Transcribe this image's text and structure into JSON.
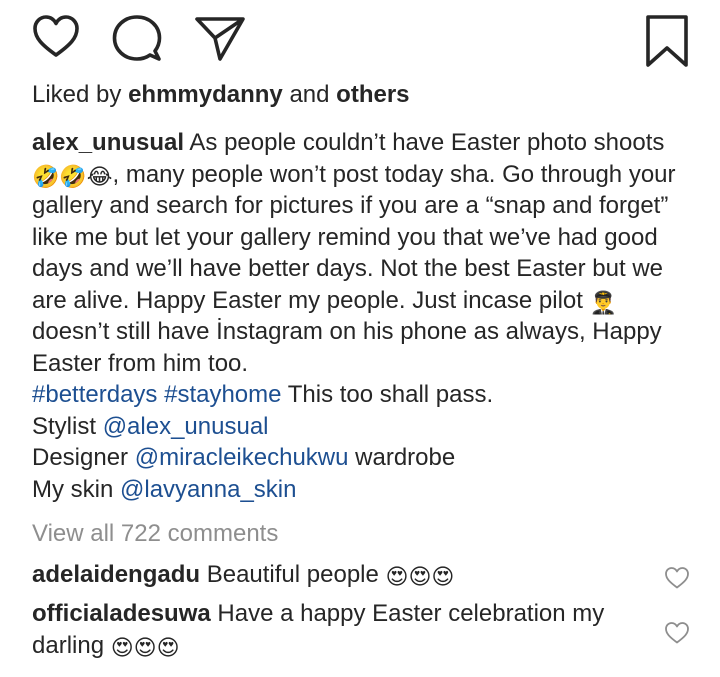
{
  "actions": {
    "like_icon": "heart-icon",
    "comment_icon": "comment-icon",
    "share_icon": "send-icon",
    "save_icon": "bookmark-icon"
  },
  "likes": {
    "prefix": "Liked by ",
    "user": "ehmmydanny",
    "middle": " and ",
    "others": "others"
  },
  "caption": {
    "author": "alex_unusual",
    "line1": " As people couldn’t have Easter photo shoots ",
    "emojis1": "🤣🤣😂",
    "line2": ", many people won’t post today sha. Go through your gallery and search for pictures if you are a “snap and forget” like me but let your gallery remind you that we’ve had good days and we’ll have better days. Not the best Easter but we are alive. Happy Easter my people. Just incase pilot ",
    "emoji_pilot": "👨‍✈️",
    "line3": " doesn’t still have İnstagram on his phone as always, Happy Easter from him too.",
    "hashtag1": "#betterdays",
    "hashtag2": "#stayhome",
    "after_hashtags": " This too shall pass.",
    "stylist_label": "Stylist ",
    "stylist_handle": "@alex_unusual",
    "designer_label": "Designer ",
    "designer_handle": "@miracleikechukwu",
    "designer_suffix": " wardrobe",
    "skin_label": "My skin ",
    "skin_handle": "@lavyanna_skin"
  },
  "view_all": "View all 722 comments",
  "comments": [
    {
      "user": "adelaidengadu",
      "text": " Beautiful people ",
      "emojis": "😍😍😍"
    },
    {
      "user": "officialadesuwa",
      "text": " Have a happy Easter celebration my darling ",
      "emojis": "😍😍😍"
    }
  ]
}
